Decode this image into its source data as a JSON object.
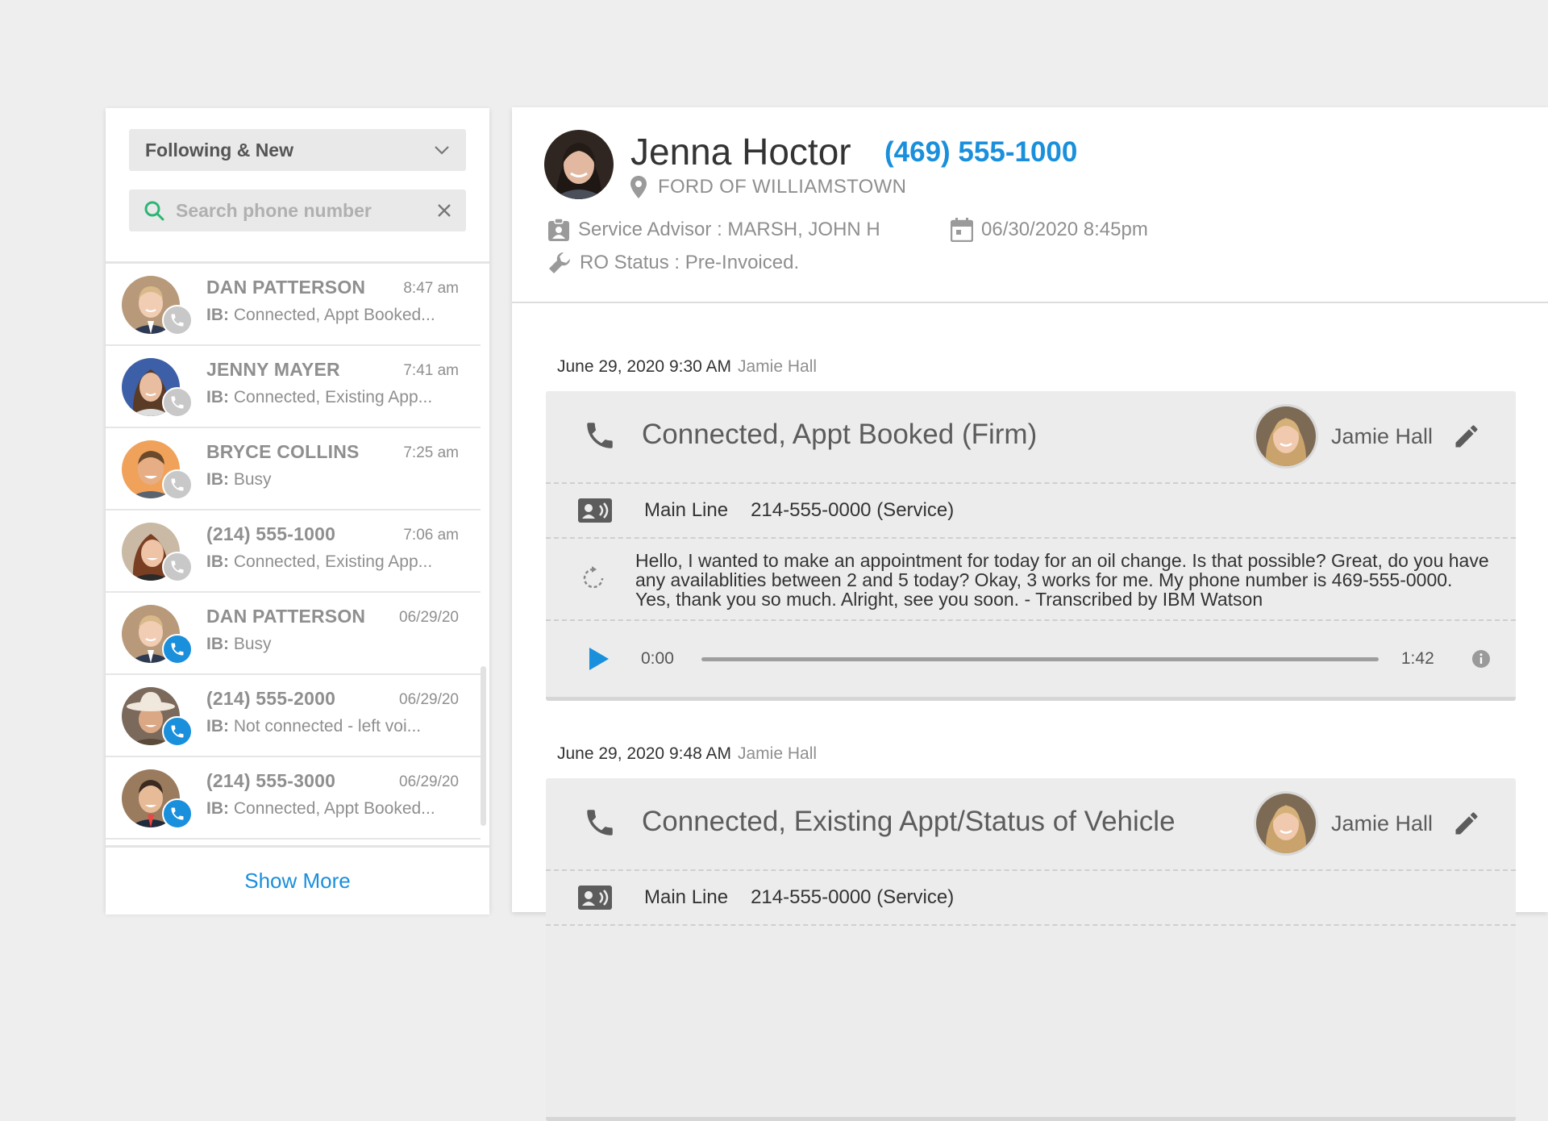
{
  "left": {
    "filter": {
      "label": "Following & New"
    },
    "search": {
      "placeholder": "Search phone number"
    },
    "items": [
      {
        "name": "DAN PATTERSON",
        "time": "8:47 am",
        "prefix": "IB:",
        "status": "Connected, Appt Booked...",
        "badge": "gray",
        "avatar": "a1"
      },
      {
        "name": "JENNY MAYER",
        "time": "7:41 am",
        "prefix": "IB:",
        "status": "Connected, Existing App...",
        "badge": "gray",
        "avatar": "a2"
      },
      {
        "name": "BRYCE COLLINS",
        "time": "7:25 am",
        "prefix": "IB:",
        "status": "Busy",
        "badge": "gray",
        "avatar": "a3"
      },
      {
        "name": "(214) 555-1000",
        "time": "7:06 am",
        "prefix": "IB:",
        "status": "Connected, Existing App...",
        "badge": "gray",
        "avatar": "a4"
      },
      {
        "name": "DAN PATTERSON",
        "time": "06/29/20",
        "prefix": "IB:",
        "status": "Busy",
        "badge": "blue",
        "avatar": "a1"
      },
      {
        "name": "(214) 555-2000",
        "time": "06/29/20",
        "prefix": "IB:",
        "status": "Not connected - left voi...",
        "badge": "blue",
        "avatar": "a5"
      },
      {
        "name": "(214) 555-3000",
        "time": "06/29/20",
        "prefix": "IB:",
        "status": "Connected, Appt Booked...",
        "badge": "blue",
        "avatar": "a6"
      }
    ],
    "show_more": "Show More"
  },
  "contact": {
    "name": "Jenna Hoctor",
    "phone": "(469) 555-1000",
    "dealer": "FORD OF WILLIAMSTOWN",
    "advisor": "Service Advisor : MARSH, JOHN H",
    "datetime": "06/30/2020 8:45pm",
    "ro_status": "RO Status : Pre-Invoiced."
  },
  "entries": [
    {
      "date": "June 29, 2020 9:30 AM",
      "by": "Jamie Hall",
      "title": "Connected, Appt Booked (Firm)",
      "user": "Jamie Hall",
      "line_label": "Main Line",
      "line_value": "214-555-0000 (Service)",
      "transcript": "Hello, I wanted to make an appointment for today for an oil change. Is that possible? Great, do you have any availablities between 2 and 5 today? Okay, 3 works for me. My phone number is 469-555-0000. Yes, thank you so much. Alright, see you soon. - Transcribed by IBM Watson",
      "audio": {
        "current": "0:00",
        "duration": "1:42",
        "progress": 0
      }
    },
    {
      "date": "June 29, 2020 9:48 AM",
      "by": "Jamie Hall",
      "title": "Connected, Existing Appt/Status of Vehicle",
      "user": "Jamie Hall",
      "line_label": "Main Line",
      "line_value": "214-555-0000 (Service)"
    }
  ],
  "colors": {
    "accent": "#1a8fdc",
    "muted": "#8f8f8f",
    "card": "#ececec",
    "search_icon": "#2bb673"
  }
}
